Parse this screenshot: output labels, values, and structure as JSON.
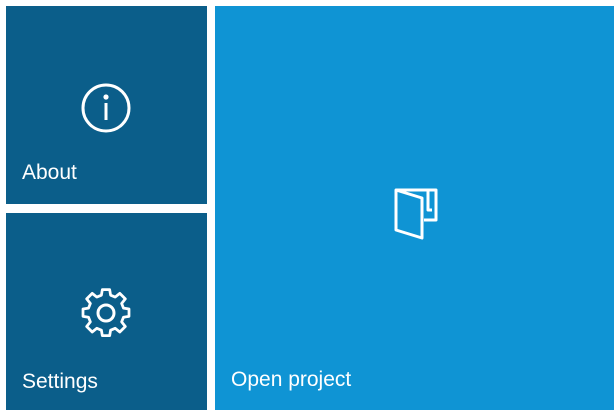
{
  "tiles": {
    "about": {
      "label": "About",
      "icon": "info-circle-icon",
      "color": "#0b5e8a"
    },
    "settings": {
      "label": "Settings",
      "icon": "gear-icon",
      "color": "#0b5e8a"
    },
    "open_project": {
      "label": "Open project",
      "icon": "folder-open-icon",
      "color": "#0f94d4"
    }
  }
}
